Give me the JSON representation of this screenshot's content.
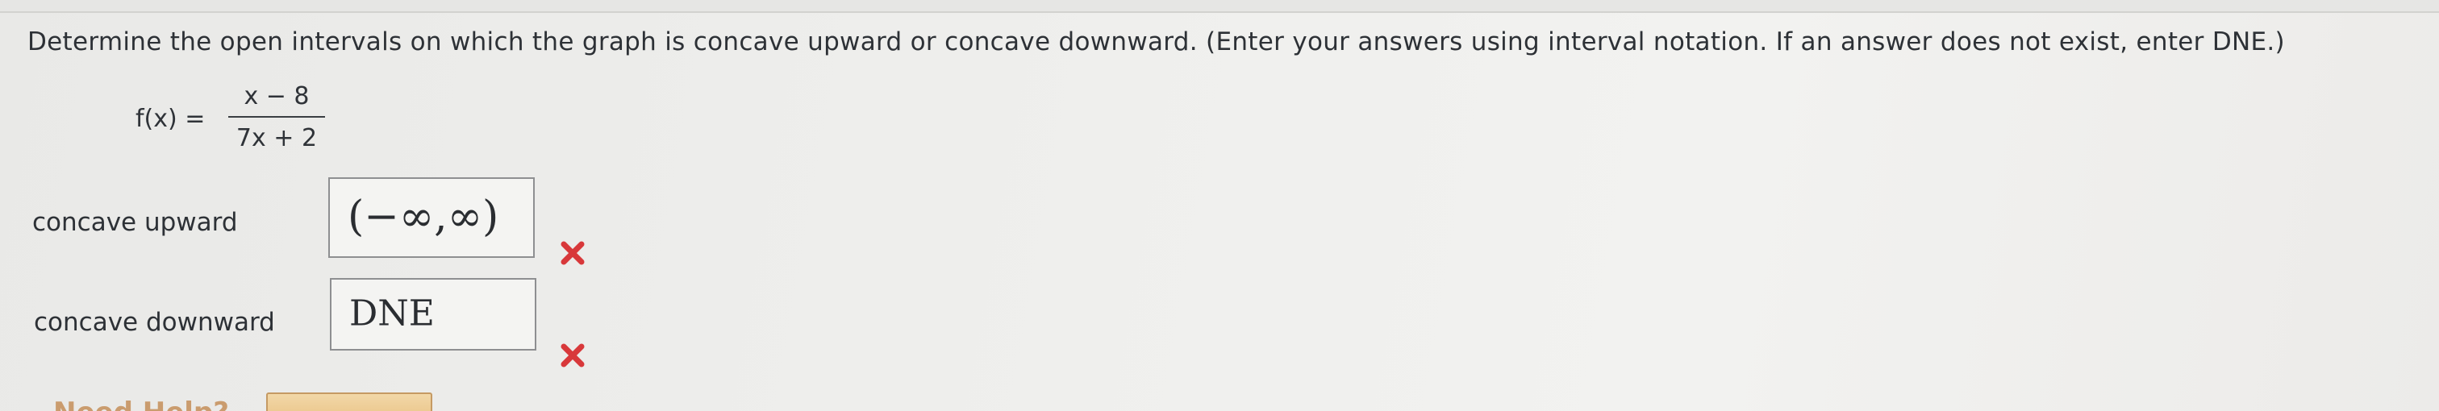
{
  "question": {
    "text": "Determine the open intervals on which the graph is concave upward or concave downward. (Enter your answers using interval notation. If an answer does not exist, enter DNE.)"
  },
  "function": {
    "label": "f(x) =",
    "numerator": "x − 8",
    "denominator": "7x + 2"
  },
  "answers": [
    {
      "label": "concave upward",
      "value": "(−∞,∞)",
      "status": "incorrect"
    },
    {
      "label": "concave downward",
      "value": "DNE",
      "status": "incorrect"
    }
  ],
  "help": {
    "text": "Need Help?"
  },
  "colors": {
    "incorrect": "#d8383a",
    "help_text": "#c58f59",
    "button": "#e9c184"
  },
  "icons": {
    "incorrect": "x-mark-icon"
  }
}
